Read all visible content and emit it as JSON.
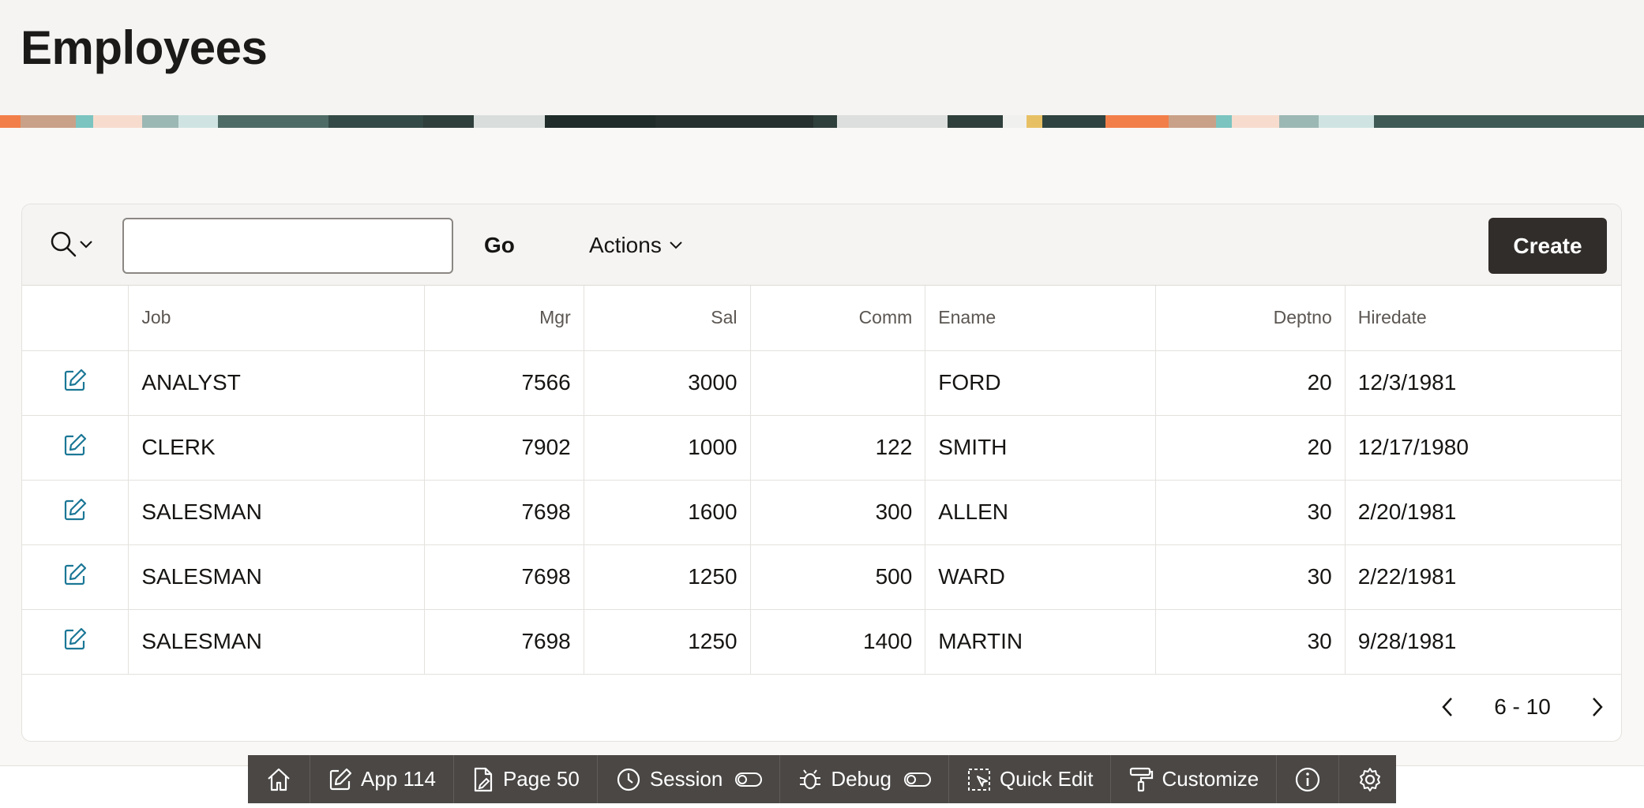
{
  "page": {
    "title": "Employees"
  },
  "toolbar": {
    "search_placeholder": "",
    "go_label": "Go",
    "actions_label": "Actions",
    "create_label": "Create"
  },
  "report": {
    "columns": [
      "Job",
      "Mgr",
      "Sal",
      "Comm",
      "Ename",
      "Deptno",
      "Hiredate"
    ],
    "rows": [
      {
        "job": "ANALYST",
        "mgr": "7566",
        "sal": "3000",
        "comm": "",
        "ename": "FORD",
        "deptno": "20",
        "hiredate": "12/3/1981"
      },
      {
        "job": "CLERK",
        "mgr": "7902",
        "sal": "1000",
        "comm": "122",
        "ename": "SMITH",
        "deptno": "20",
        "hiredate": "12/17/1980"
      },
      {
        "job": "SALESMAN",
        "mgr": "7698",
        "sal": "1600",
        "comm": "300",
        "ename": "ALLEN",
        "deptno": "30",
        "hiredate": "2/20/1981"
      },
      {
        "job": "SALESMAN",
        "mgr": "7698",
        "sal": "1250",
        "comm": "500",
        "ename": "WARD",
        "deptno": "30",
        "hiredate": "2/22/1981"
      },
      {
        "job": "SALESMAN",
        "mgr": "7698",
        "sal": "1250",
        "comm": "1400",
        "ename": "MARTIN",
        "deptno": "30",
        "hiredate": "9/28/1981"
      }
    ]
  },
  "pagination": {
    "range_label": "6 - 10"
  },
  "dev_toolbar": {
    "app_label": "App 114",
    "page_label": "Page 50",
    "session_label": "Session",
    "debug_label": "Debug",
    "quick_edit_label": "Quick Edit",
    "customize_label": "Customize"
  },
  "colors": {
    "create_button_bg": "#312d2a",
    "edit_icon": "#1b7796",
    "dev_toolbar_bg": "#4a4745"
  },
  "icons": {
    "search": "search-icon",
    "edit": "edit-icon",
    "home": "home-icon",
    "info": "info-icon",
    "settings": "gear-icon"
  }
}
